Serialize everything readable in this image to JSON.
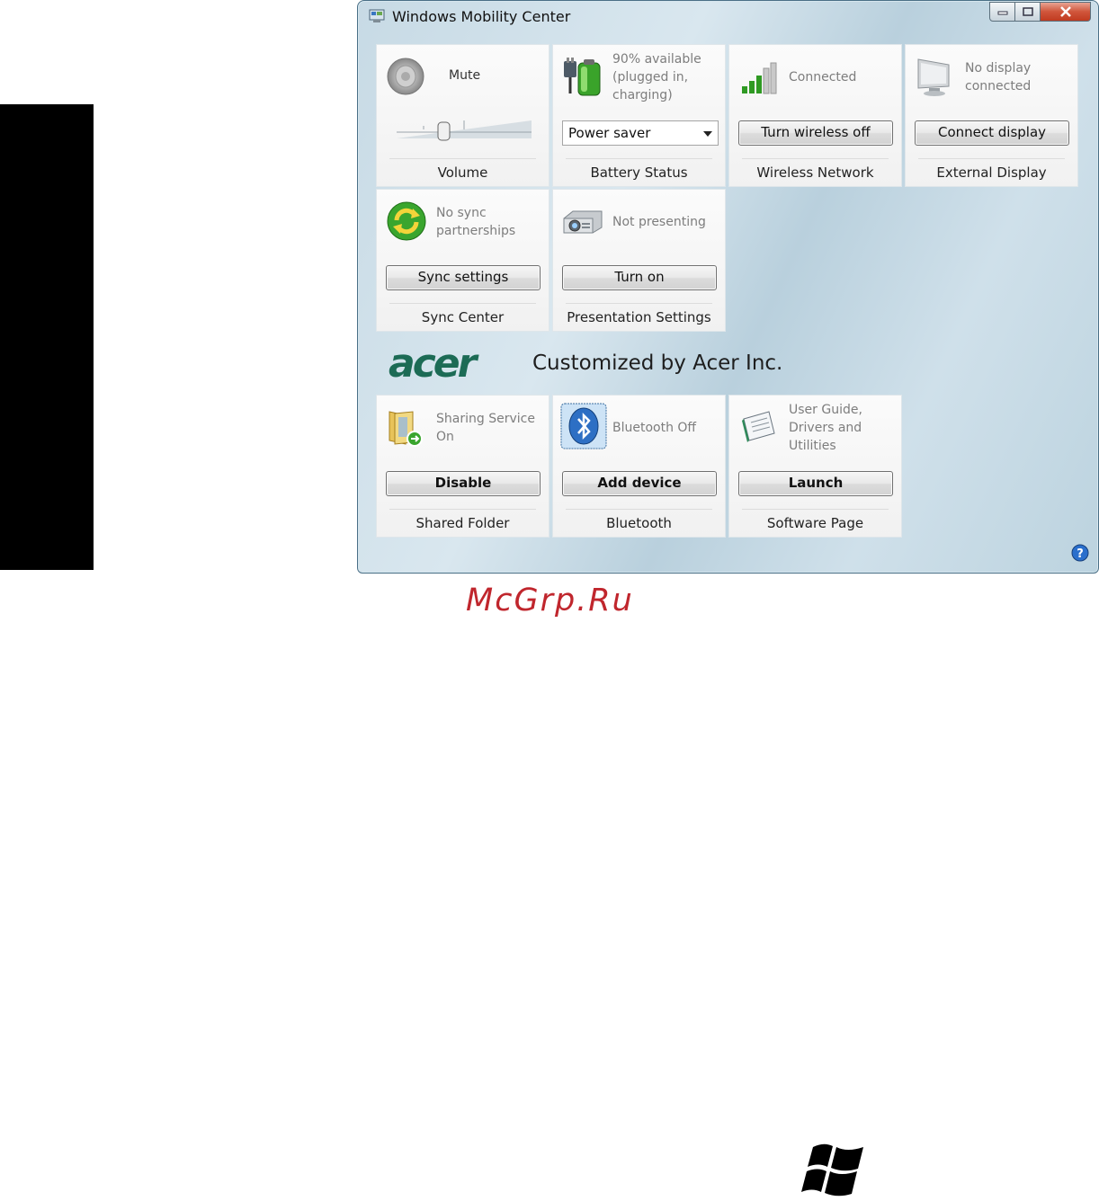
{
  "window": {
    "title": "Windows Mobility Center"
  },
  "tiles": {
    "volume": {
      "status": "Mute",
      "caption": "Volume",
      "level": 0.35
    },
    "battery": {
      "status": "90% available (plugged in, charging)",
      "select_value": "Power saver",
      "caption": "Battery Status"
    },
    "wireless": {
      "status": "Connected",
      "button": "Turn wireless off",
      "caption": "Wireless Network"
    },
    "display": {
      "status": "No display connected",
      "button": "Connect display",
      "caption": "External Display"
    },
    "sync": {
      "status": "No sync partnerships",
      "button": "Sync settings",
      "caption": "Sync Center"
    },
    "presentation": {
      "status": "Not presenting",
      "button": "Turn on",
      "caption": "Presentation Settings"
    },
    "shared": {
      "status": "Sharing Service On",
      "button": "Disable",
      "caption": "Shared Folder"
    },
    "bluetooth": {
      "status": "Bluetooth Off",
      "button": "Add device",
      "caption": "Bluetooth"
    },
    "software": {
      "status": "User Guide, Drivers and Utilities",
      "button": "Launch",
      "caption": "Software Page"
    }
  },
  "brand": {
    "logo_text": "acer",
    "customized_text": "Customized by Acer Inc."
  },
  "watermark": "McGrp.Ru",
  "colors": {
    "window_frame": "#4a6f86",
    "close_button": "#c8452a",
    "acer_green": "#1c6b55",
    "watermark": "#c0262d"
  }
}
